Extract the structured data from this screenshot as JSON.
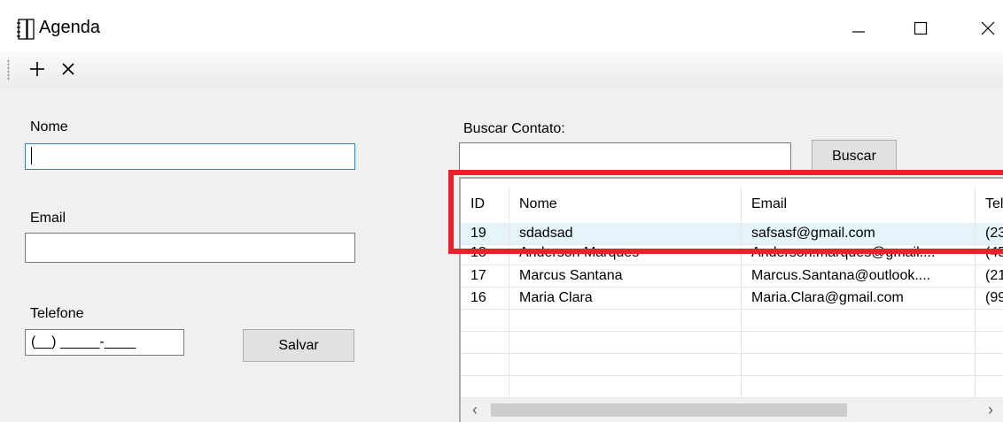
{
  "window": {
    "title": "Agenda",
    "icon": "notebook-icon",
    "controls": {
      "minimize": "minimize-icon",
      "maximize": "maximize-icon",
      "close": "close-icon"
    }
  },
  "toolbar": {
    "add_icon": "plus-icon",
    "delete_icon": "x-icon"
  },
  "form": {
    "nome_label": "Nome",
    "nome_value": "",
    "email_label": "Email",
    "email_value": "",
    "telefone_label": "Telefone",
    "telefone_value": "(__) _____-____",
    "save_label": "Salvar"
  },
  "search": {
    "label": "Buscar Contato:",
    "value": "",
    "button_label": "Buscar"
  },
  "grid": {
    "columns": [
      "ID",
      "Nome",
      "Email",
      "Tel"
    ],
    "rows": [
      [
        "19",
        "sdadsad",
        "safsasf@gmail.com",
        "(23"
      ],
      [
        "18",
        "Anderson Marques",
        "Anderson.marques@gmail....",
        "(45"
      ],
      [
        "17",
        "Marcus Santana",
        "Marcus.Santana@outlook....",
        "(21"
      ],
      [
        "16",
        "Maria Clara",
        "Maria.Clara@gmail.com",
        "(99"
      ]
    ],
    "scroll_left_icon": "chevron-left-icon",
    "scroll_right_icon": "chevron-right-icon"
  },
  "colors": {
    "highlight": "#e8222c",
    "focus_border": "#3c7fb1",
    "window_bg": "#f0f0f0"
  }
}
